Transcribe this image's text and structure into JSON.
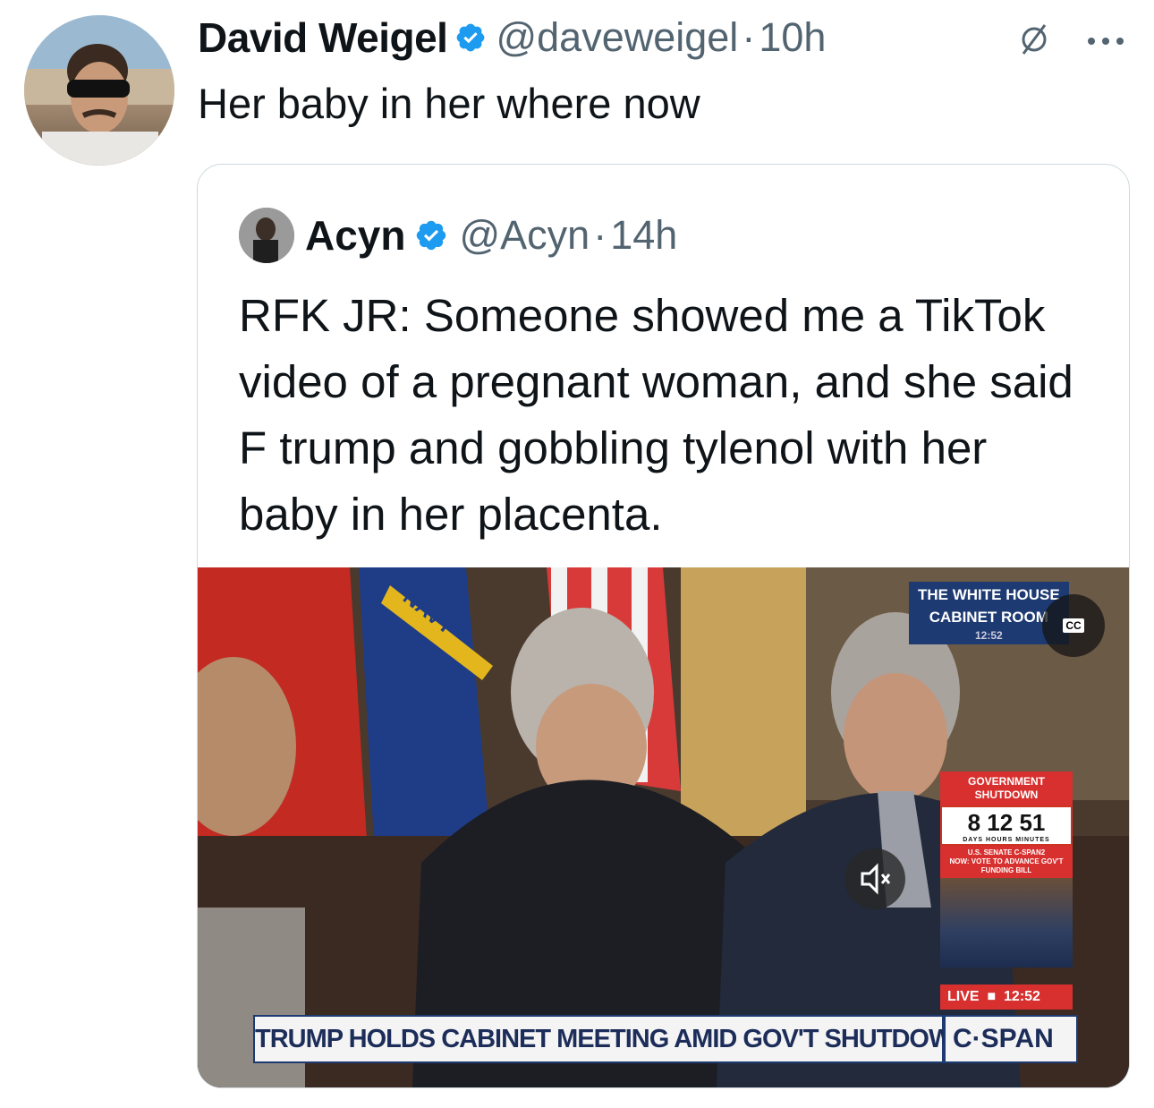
{
  "tweet": {
    "author_name": "David Weigel",
    "handle": "@daveweigel",
    "separator": "·",
    "time": "10h",
    "text": "Her baby in her where now",
    "avatar_icon": "user-avatar-photo",
    "verified_icon": "verified-badge-icon",
    "mute_icon": "muted-conversation-icon",
    "more_icon": "more-options-icon"
  },
  "quote": {
    "author_name": "Acyn",
    "handle": "@Acyn",
    "separator": "·",
    "time": "14h",
    "text": "RFK JR: Someone showed me a TikTok video of a pregnant woman, and she said F trump and gobbling tylenol with her baby in her placenta."
  },
  "video": {
    "location_line1": "THE WHITE HOUSE",
    "location_line2": "CABINET ROOM",
    "location_time": "12:52",
    "cc_label": "CC",
    "shutdown_title": "GOVERNMENT SHUTDOWN",
    "shutdown_count": "8 12 51",
    "shutdown_units": "DAYS HOURS MINUTES",
    "senate_line1": "U.S. SENATE C-SPAN2",
    "senate_line2": "NOW: VOTE TO ADVANCE GOV'T FUNDING BILL",
    "live_label": "LIVE",
    "live_time": "12:52",
    "chyron": "TRUMP HOLDS CABINET MEETING AMID GOV'T SHUTDOWN",
    "network": "C·SPAN",
    "volume_icon": "volume-muted-icon"
  },
  "colors": {
    "verified_blue": "#1d9bf0",
    "secondary_text": "#536471",
    "border": "#cfd9de",
    "cspan_red": "#d7302f",
    "cspan_navy": "#1d3a72"
  }
}
